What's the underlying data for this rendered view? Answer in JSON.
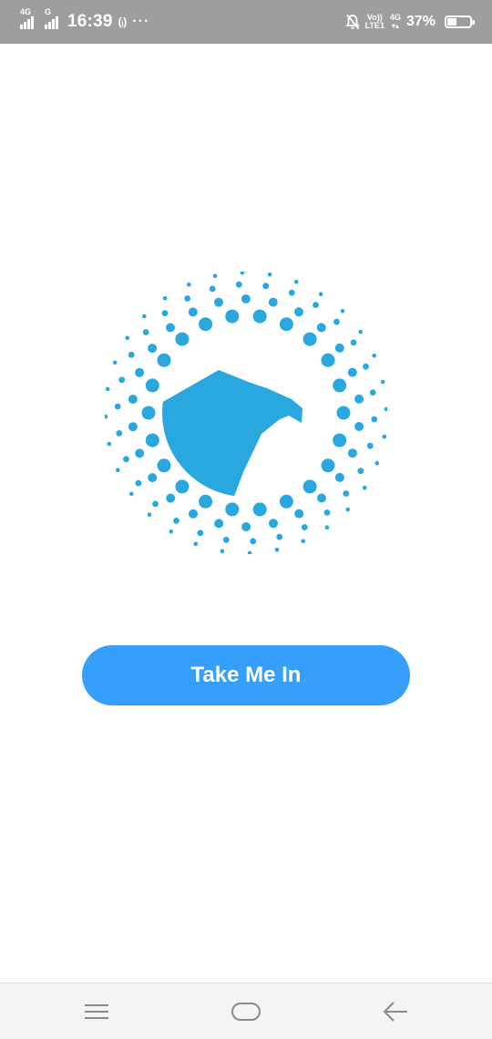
{
  "status_bar": {
    "signal1_tag": "4G",
    "signal2_tag": "G",
    "time": "16:39",
    "hotspot_glyph": "(ᵢ)",
    "more_glyph": "···",
    "volte_top": "Vo))",
    "volte_bottom": "LTE1",
    "net_tag": "4G",
    "battery_percent": "37%",
    "battery_level": 0.37,
    "icons": [
      "signal-4g-icon",
      "signal-g-icon",
      "hotspot-icon",
      "more-dots-icon",
      "mute-bell-icon",
      "volte-icon",
      "data-4g-icon",
      "battery-icon"
    ]
  },
  "main": {
    "logo_icon": "eagle-dotted-circle-logo",
    "brand_color": "#29a8e0",
    "cta_label": "Take Me In",
    "cta_color": "#359ff9"
  },
  "nav_bar": {
    "icons": [
      "menu-icon",
      "home-icon",
      "back-arrow-icon"
    ]
  }
}
